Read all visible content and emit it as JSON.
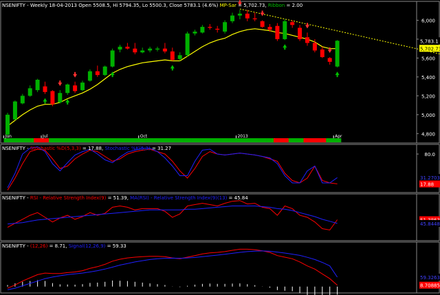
{
  "colors": {
    "background": "#000000",
    "frame": "#8a8a8a",
    "up": "#00b000",
    "down": "#ff0000",
    "ma": "#ffff00",
    "trend": "#ffff00",
    "arrow_up": "#00c000",
    "arrow_down": "#ff3030",
    "stoch_k": "#ff0000",
    "stoch_d": "#2020ff",
    "rsi": "#ff0000",
    "rsi_avg": "#2020ff",
    "macd": "#ff0000",
    "signal": "#2020ff",
    "hist": "#ffffff"
  },
  "chart_data": [
    {
      "type": "candlestick",
      "title_parts": [
        {
          "text": "NSENIFTY - Weekly 18-04-2013 Open 5508.5, Hi 5794.35, Lo 5500.3, Close 5783.1 (4.6%) ",
          "color": "#ffffff"
        },
        {
          "text": "MP-Sar",
          "color": "#ffff00"
        },
        {
          "text": " = 5,702.73, ",
          "color": "#ffffff"
        },
        {
          "text": "Ribbon",
          "color": "#00c000"
        },
        {
          "text": " = 2.00",
          "color": "#ffffff"
        }
      ],
      "ylim": [
        4700,
        6200
      ],
      "y_ticks": [
        4800,
        5000,
        5200,
        5400,
        5600,
        5800,
        6000
      ],
      "y_tick_labels": [
        "4,800",
        "5,000",
        "5,200",
        "5,400",
        "5,600",
        "5,800",
        "6,000"
      ],
      "x_tick_labels": [
        {
          "label": "Jun",
          "index": 0
        },
        {
          "label": "Jul",
          "index": 5
        },
        {
          "label": "Oct",
          "index": 18
        },
        {
          "label": "2013",
          "index": 31
        },
        {
          "label": "Apr",
          "index": 44
        }
      ],
      "candles": [
        {
          "o": 4790,
          "h": 5020,
          "l": 4770,
          "c": 5000
        },
        {
          "o": 4950,
          "h": 5150,
          "l": 4940,
          "c": 5140
        },
        {
          "o": 5120,
          "h": 5220,
          "l": 5110,
          "c": 5200
        },
        {
          "o": 5200,
          "h": 5310,
          "l": 5190,
          "c": 5280
        },
        {
          "o": 5260,
          "h": 5380,
          "l": 5240,
          "c": 5370
        },
        {
          "o": 5300,
          "h": 5350,
          "l": 5220,
          "c": 5240
        },
        {
          "o": 5250,
          "h": 5260,
          "l": 5090,
          "c": 5110
        },
        {
          "o": 5130,
          "h": 5260,
          "l": 5120,
          "c": 5230
        },
        {
          "o": 5230,
          "h": 5330,
          "l": 5210,
          "c": 5320
        },
        {
          "o": 5310,
          "h": 5350,
          "l": 5230,
          "c": 5250
        },
        {
          "o": 5260,
          "h": 5360,
          "l": 5250,
          "c": 5340
        },
        {
          "o": 5360,
          "h": 5480,
          "l": 5350,
          "c": 5460
        },
        {
          "o": 5460,
          "h": 5520,
          "l": 5400,
          "c": 5420
        },
        {
          "o": 5420,
          "h": 5520,
          "l": 5410,
          "c": 5510
        },
        {
          "o": 5510,
          "h": 5700,
          "l": 5500,
          "c": 5680
        },
        {
          "o": 5690,
          "h": 5740,
          "l": 5660,
          "c": 5720
        },
        {
          "o": 5720,
          "h": 5760,
          "l": 5690,
          "c": 5700
        },
        {
          "o": 5700,
          "h": 5760,
          "l": 5640,
          "c": 5660
        },
        {
          "o": 5660,
          "h": 5710,
          "l": 5650,
          "c": 5680
        },
        {
          "o": 5680,
          "h": 5720,
          "l": 5660,
          "c": 5700
        },
        {
          "o": 5690,
          "h": 5720,
          "l": 5670,
          "c": 5700
        },
        {
          "o": 5700,
          "h": 5760,
          "l": 5650,
          "c": 5670
        },
        {
          "o": 5670,
          "h": 5710,
          "l": 5570,
          "c": 5580
        },
        {
          "o": 5590,
          "h": 5660,
          "l": 5570,
          "c": 5630
        },
        {
          "o": 5630,
          "h": 5880,
          "l": 5610,
          "c": 5860
        },
        {
          "o": 5860,
          "h": 5900,
          "l": 5840,
          "c": 5880
        },
        {
          "o": 5870,
          "h": 5950,
          "l": 5860,
          "c": 5930
        },
        {
          "o": 5930,
          "h": 5960,
          "l": 5900,
          "c": 5920
        },
        {
          "o": 5910,
          "h": 5940,
          "l": 5870,
          "c": 5900
        },
        {
          "o": 5880,
          "h": 6000,
          "l": 5860,
          "c": 5980
        },
        {
          "o": 5990,
          "h": 6080,
          "l": 5970,
          "c": 6050
        },
        {
          "o": 6050,
          "h": 6110,
          "l": 6010,
          "c": 6070
        },
        {
          "o": 6070,
          "h": 6110,
          "l": 5990,
          "c": 6020
        },
        {
          "o": 6020,
          "h": 6080,
          "l": 5990,
          "c": 6010
        },
        {
          "o": 5990,
          "h": 6000,
          "l": 5920,
          "c": 5930
        },
        {
          "o": 5930,
          "h": 5960,
          "l": 5880,
          "c": 5900
        },
        {
          "o": 5940,
          "h": 5970,
          "l": 5780,
          "c": 5800
        },
        {
          "o": 5800,
          "h": 6010,
          "l": 5790,
          "c": 5990
        },
        {
          "o": 5980,
          "h": 6000,
          "l": 5920,
          "c": 5950
        },
        {
          "o": 5920,
          "h": 5950,
          "l": 5780,
          "c": 5800
        },
        {
          "o": 5820,
          "h": 5870,
          "l": 5730,
          "c": 5760
        },
        {
          "o": 5760,
          "h": 5800,
          "l": 5660,
          "c": 5680
        },
        {
          "o": 5690,
          "h": 5720,
          "l": 5600,
          "c": 5610
        },
        {
          "o": 5600,
          "h": 5610,
          "l": 5530,
          "c": 5560
        },
        {
          "o": 5510,
          "h": 5790,
          "l": 5500,
          "c": 5783
        }
      ],
      "ma_line": [
        4880,
        4940,
        5000,
        5050,
        5090,
        5110,
        5110,
        5130,
        5170,
        5200,
        5230,
        5270,
        5320,
        5380,
        5440,
        5480,
        5510,
        5530,
        5550,
        5560,
        5570,
        5580,
        5570,
        5570,
        5620,
        5670,
        5720,
        5760,
        5790,
        5810,
        5850,
        5880,
        5900,
        5910,
        5900,
        5890,
        5870,
        5860,
        5840,
        5820,
        5800,
        5770,
        5720,
        5700,
        5700
      ],
      "sar_markers": [
        {
          "index": 5,
          "side": "below"
        },
        {
          "index": 7,
          "side": "above"
        },
        {
          "index": 8,
          "side": "below"
        },
        {
          "index": 9,
          "side": "above"
        },
        {
          "index": 14,
          "side": "below"
        },
        {
          "index": 22,
          "side": "below"
        },
        {
          "index": 31,
          "side": "above"
        },
        {
          "index": 34,
          "side": "above"
        },
        {
          "index": 37,
          "side": "below"
        },
        {
          "index": 40,
          "side": "above"
        },
        {
          "index": 43,
          "side": "above"
        },
        {
          "index": 44,
          "side": "below"
        }
      ],
      "trendline": {
        "from": {
          "index": 31,
          "value": 6120
        },
        "to": {
          "index": 59,
          "value": 5620
        }
      },
      "ribbon": [
        "g",
        "g",
        "g",
        "g",
        "r",
        "r",
        "g",
        "g",
        "g",
        "g",
        "g",
        "g",
        "g",
        "g",
        "g",
        "g",
        "g",
        "g",
        "g",
        "g",
        "g",
        "g",
        "g",
        "g",
        "g",
        "g",
        "g",
        "g",
        "g",
        "g",
        "g",
        "g",
        "g",
        "g",
        "g",
        "g",
        "r",
        "r",
        "g",
        "g",
        "r",
        "r",
        "r",
        "g",
        "g"
      ],
      "value_labels": [
        {
          "text": "5,783.1",
          "value": 5783.1,
          "bg": "#000000",
          "color": "#ffffff"
        },
        {
          "text": "5,702.73",
          "value": 5702.73,
          "bg": "#ffff00",
          "color": "#000000"
        }
      ]
    },
    {
      "type": "line",
      "title_parts": [
        {
          "text": "NSENIFTY - ",
          "color": "#ffffff"
        },
        {
          "text": "Stochastic %D(5,3,3)",
          "color": "#ff0000"
        },
        {
          "text": " = 17.88, ",
          "color": "#ffffff"
        },
        {
          "text": "Stochastic %K(5,3)",
          "color": "#2020ff"
        },
        {
          "text": " = 31.27",
          "color": "#ffffff"
        }
      ],
      "ylim": [
        0,
        100
      ],
      "y_ticks": [
        80
      ],
      "y_tick_labels": [
        "80.0"
      ],
      "series": [
        {
          "color_key": "stoch_k",
          "values": [
            5,
            30,
            60,
            85,
            90,
            88,
            70,
            50,
            55,
            70,
            80,
            88,
            85,
            75,
            65,
            70,
            80,
            85,
            88,
            90,
            85,
            80,
            65,
            45,
            30,
            50,
            75,
            85,
            80,
            78,
            80,
            82,
            80,
            78,
            75,
            70,
            65,
            40,
            25,
            20,
            30,
            55,
            25,
            20,
            18
          ]
        },
        {
          "color_key": "stoch_d",
          "values": [
            10,
            40,
            80,
            92,
            95,
            85,
            60,
            45,
            62,
            78,
            85,
            90,
            80,
            68,
            62,
            74,
            84,
            88,
            92,
            92,
            85,
            72,
            55,
            35,
            35,
            65,
            88,
            90,
            80,
            78,
            80,
            82,
            80,
            78,
            75,
            72,
            60,
            35,
            20,
            20,
            45,
            55,
            20,
            20,
            31
          ]
        }
      ],
      "value_labels": [
        {
          "text": "31.2703",
          "value": 31.27,
          "bg": "#000000",
          "color": "#4040ff"
        },
        {
          "text": "17.88",
          "value": 17.88,
          "bg": "#ff0000",
          "color": "#ffffff"
        }
      ]
    },
    {
      "type": "line",
      "title_parts": [
        {
          "text": "NSENIFTY - ",
          "color": "#ffffff"
        },
        {
          "text": "RSI - Relative Strength Index(9)",
          "color": "#ff0000"
        },
        {
          "text": " = 51.39, ",
          "color": "#ffffff"
        },
        {
          "text": "MA(RSI) - Relative Strength Index(9)(13)",
          "color": "#2020ff"
        },
        {
          "text": " = 45.84",
          "color": "#ffffff"
        }
      ],
      "ylim": [
        20,
        90
      ],
      "y_ticks": [],
      "y_tick_labels": [],
      "series": [
        {
          "color_key": "rsi",
          "values": [
            40,
            46,
            52,
            58,
            62,
            55,
            48,
            54,
            58,
            52,
            56,
            62,
            58,
            61,
            70,
            72,
            70,
            66,
            68,
            68,
            68,
            64,
            55,
            60,
            72,
            74,
            76,
            74,
            72,
            76,
            79,
            80,
            75,
            76,
            70,
            68,
            58,
            72,
            68,
            58,
            55,
            48,
            38,
            36,
            51.39
          ]
        },
        {
          "color_key": "rsi_avg",
          "values": [
            45,
            46,
            47,
            49,
            51,
            52,
            53,
            54,
            55,
            56,
            57,
            58,
            59,
            60,
            61,
            62,
            63,
            64,
            65,
            66,
            66,
            66,
            66,
            66,
            67,
            67,
            68,
            69,
            70,
            71,
            72,
            72,
            72,
            72,
            71,
            70,
            68,
            67,
            65,
            62,
            59,
            56,
            52,
            49,
            45.84
          ]
        }
      ],
      "value_labels": [
        {
          "text": "51.3863",
          "value": 51.39,
          "bg": "#ff0000",
          "color": "#ffffff"
        },
        {
          "text": "45.8448",
          "value": 45.84,
          "bg": "#000000",
          "color": "#4040ff"
        }
      ]
    },
    {
      "type": "line",
      "title_parts": [
        {
          "text": "NSENIFTY - ",
          "color": "#ffffff"
        },
        {
          "text": "(12,26)",
          "color": "#ff0000"
        },
        {
          "text": " = 8.71, ",
          "color": "#ffffff"
        },
        {
          "text": "Signal(12,26,9)",
          "color": "#2020ff"
        },
        {
          "text": " = 59.33",
          "color": "#ffffff"
        }
      ],
      "ylim": [
        -40,
        280
      ],
      "y_ticks": [],
      "y_tick_labels": [],
      "series": [
        {
          "color_key": "macd",
          "values": [
            -10,
            10,
            35,
            55,
            75,
            85,
            82,
            82,
            88,
            92,
            100,
            115,
            125,
            140,
            160,
            172,
            180,
            185,
            188,
            190,
            190,
            188,
            180,
            175,
            185,
            195,
            205,
            212,
            215,
            220,
            228,
            235,
            235,
            232,
            225,
            215,
            195,
            185,
            175,
            155,
            130,
            110,
            80,
            50,
            8.71
          ]
        },
        {
          "color_key": "signal",
          "values": [
            -20,
            -10,
            5,
            20,
            35,
            50,
            60,
            68,
            75,
            80,
            85,
            92,
            100,
            110,
            122,
            135,
            145,
            155,
            163,
            170,
            175,
            178,
            179,
            178,
            180,
            183,
            188,
            193,
            198,
            203,
            209,
            215,
            220,
            223,
            224,
            222,
            217,
            211,
            204,
            196,
            184,
            170,
            152,
            130,
            59.33
          ]
        }
      ],
      "histogram": [
        10,
        20,
        30,
        35,
        40,
        35,
        22,
        14,
        13,
        12,
        15,
        23,
        25,
        30,
        38,
        37,
        35,
        30,
        25,
        20,
        15,
        10,
        1,
        -3,
        5,
        12,
        17,
        19,
        17,
        17,
        19,
        20,
        15,
        9,
        1,
        -7,
        -22,
        -26,
        -29,
        -41,
        -54,
        -60,
        -72,
        -80,
        -51
      ],
      "value_labels": [
        {
          "text": "59.3263",
          "value": 59.33,
          "bg": "#000000",
          "color": "#4040ff"
        },
        {
          "text": "8.70885",
          "value": 8.71,
          "bg": "#ff0000",
          "color": "#ffffff"
        }
      ]
    }
  ]
}
